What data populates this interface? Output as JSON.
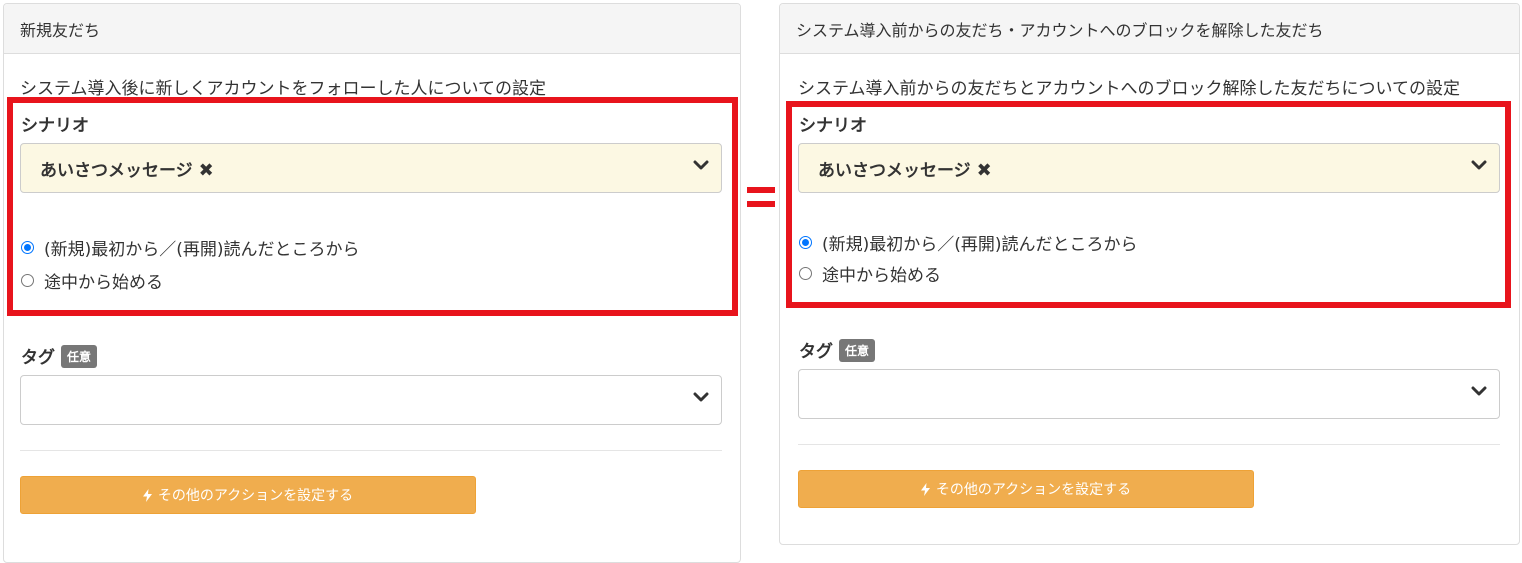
{
  "left": {
    "title": "新規友だち",
    "description": "システム導入後に新しくアカウントをフォローした人についての設定",
    "scenario_label": "シナリオ",
    "scenario_value": "あいさつメッセージ",
    "remove_glyph": "✖",
    "radio_options": [
      "(新規)最初から／(再開)読んだところから",
      "途中から始める"
    ],
    "selected_option": 0,
    "tag_label": "タグ",
    "tag_badge": "任意",
    "action_button": "その他のアクションを設定する"
  },
  "right": {
    "title": "システム導入前からの友だち・アカウントへのブロックを解除した友だち",
    "description": "システム導入前からの友だちとアカウントへのブロック解除した友だちについての設定",
    "scenario_label": "シナリオ",
    "scenario_value": "あいさつメッセージ",
    "remove_glyph": "✖",
    "radio_options": [
      "(新規)最初から／(再開)読んだところから",
      "途中から始める"
    ],
    "selected_option": 0,
    "tag_label": "タグ",
    "tag_badge": "任意",
    "action_button": "その他のアクションを設定する"
  },
  "colors": {
    "highlight_frame": "#e8141c",
    "selected_scenario_bg": "#fcf8e3",
    "action_button_bg": "#f0ad4e",
    "radio_checked": "#0075ff"
  },
  "icons": {
    "dropdown": "chevron-down-icon",
    "remove": "close-icon",
    "action": "bolt-icon"
  }
}
